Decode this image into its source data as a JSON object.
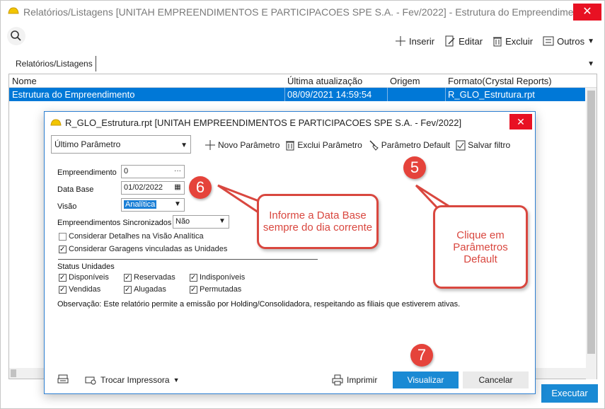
{
  "window": {
    "title": "Relatórios/Listagens [UNITAH EMPREENDIMENTOS E PARTICIPACOES SPE S.A. - Fev/2022]  - Estrutura do Empreendimento"
  },
  "toolbar": {
    "insert": "Inserir",
    "edit": "Editar",
    "delete": "Excluir",
    "others": "Outros"
  },
  "tab": {
    "label": "Relatórios/Listagens"
  },
  "grid": {
    "columns": [
      "Nome",
      "Última atualização",
      "Origem",
      "Formato(Crystal Reports)"
    ],
    "rows": [
      {
        "name": "Estrutura do Empreendimento",
        "updated": "08/09/2021 14:59:54",
        "origin": "",
        "format": "R_GLO_Estrutura.rpt"
      }
    ]
  },
  "execute_label": "Executar",
  "dialog": {
    "title": "R_GLO_Estrutura.rpt [UNITAH EMPREENDIMENTOS E PARTICIPACOES SPE S.A. - Fev/2022]",
    "param_select": "Último Parâmetro",
    "toolbar": {
      "new": "Novo Parâmetro",
      "delete": "Exclui Parâmetro",
      "default": "Parâmetro Default",
      "save": "Salvar filtro"
    },
    "fields": {
      "empreendimento_label": "Empreendimento",
      "empreendimento_value": "0",
      "database_label": "Data Base",
      "database_value": "01/02/2022",
      "visao_label": "Visão",
      "visao_value": "Analítica",
      "sincronizados_label": "Empreendimentos Sincronizados",
      "sincronizados_value": "Não"
    },
    "checks": {
      "detalhes": "Considerar Detalhes na Visão Analítica",
      "garagens": "Considerar Garagens vinculadas as Unidades"
    },
    "status": {
      "title": "Status Unidades",
      "items": [
        "Disponíveis",
        "Reservadas",
        "Indisponíveis",
        "Vendidas",
        "Alugadas",
        "Permutadas"
      ]
    },
    "observacao": "Observação: Este relatório permite a emissão por Holding/Consolidadora, respeitando as filiais que estiverem ativas.",
    "footer": {
      "trocar": "Trocar Impressora",
      "imprimir": "Imprimir",
      "visualizar": "Visualizar",
      "cancelar": "Cancelar"
    }
  },
  "annotations": {
    "badge5": "5",
    "badge6": "6",
    "badge7": "7",
    "callout6": "Informe a Data Base sempre do dia corrente",
    "callout5": "Clique em Parâmetros Default"
  }
}
